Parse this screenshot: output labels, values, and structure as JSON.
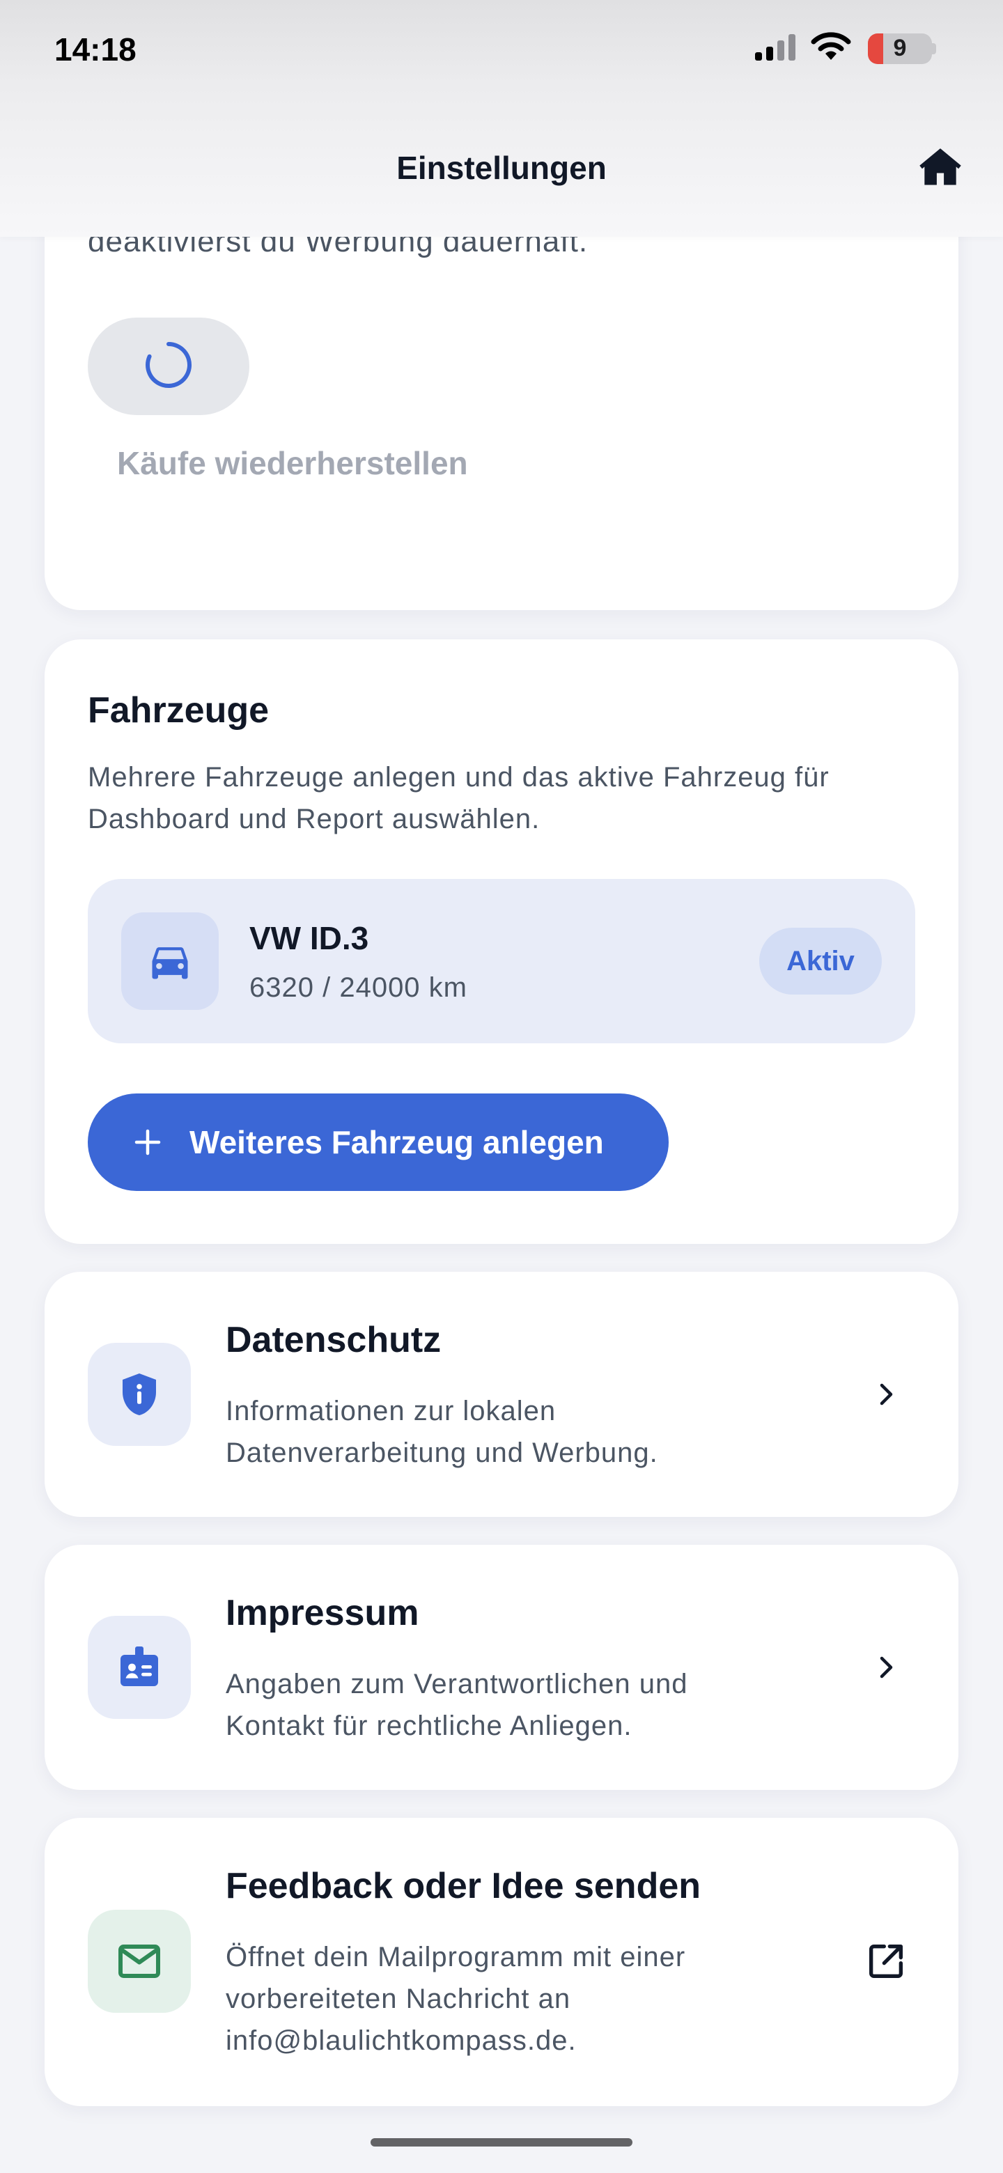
{
  "status_bar": {
    "time": "14:18",
    "battery_level": "9",
    "icons": [
      "signal-icon",
      "wifi-icon",
      "battery-icon"
    ]
  },
  "nav": {
    "title": "Einstellungen",
    "home_icon": "home-icon"
  },
  "premium_card": {
    "partial_text": "deaktivierst du Werbung dauerhaft.",
    "loading_icon": "spinner-icon",
    "restore_label": "Käufe wiederherstellen"
  },
  "vehicles": {
    "title": "Fahrzeuge",
    "description": "Mehrere Fahrzeuge anlegen und das aktive Fahrzeug für Dashboard und Report auswählen.",
    "items": [
      {
        "name": "VW ID.3",
        "km": "6320 / 24000 km",
        "badge": "Aktiv",
        "icon": "car-icon"
      }
    ],
    "add_button_label": "Weiteres Fahrzeug anlegen"
  },
  "links": {
    "privacy": {
      "title": "Datenschutz",
      "description": "Informationen zur lokalen Datenverarbeitung und Werbung.",
      "icon": "shield-info-icon",
      "action_icon": "chevron-right-icon"
    },
    "imprint": {
      "title": "Impressum",
      "description": "Angaben zum Verantwortlichen und Kontakt für rechtliche Anliegen.",
      "icon": "id-badge-icon",
      "action_icon": "chevron-right-icon"
    },
    "feedback": {
      "title": "Feedback oder Idee senden",
      "description": "Öffnet dein Mailprogramm mit einer vorbereiteten Nachricht an info@blaulichtkompass.de.",
      "icon": "mail-icon",
      "action_icon": "open-external-icon"
    }
  },
  "colors": {
    "accent": "#3b67d6",
    "background": "#f3f4f8",
    "text_primary": "#111827",
    "text_secondary": "#4b5563",
    "mail_green": "#2f8a57"
  }
}
